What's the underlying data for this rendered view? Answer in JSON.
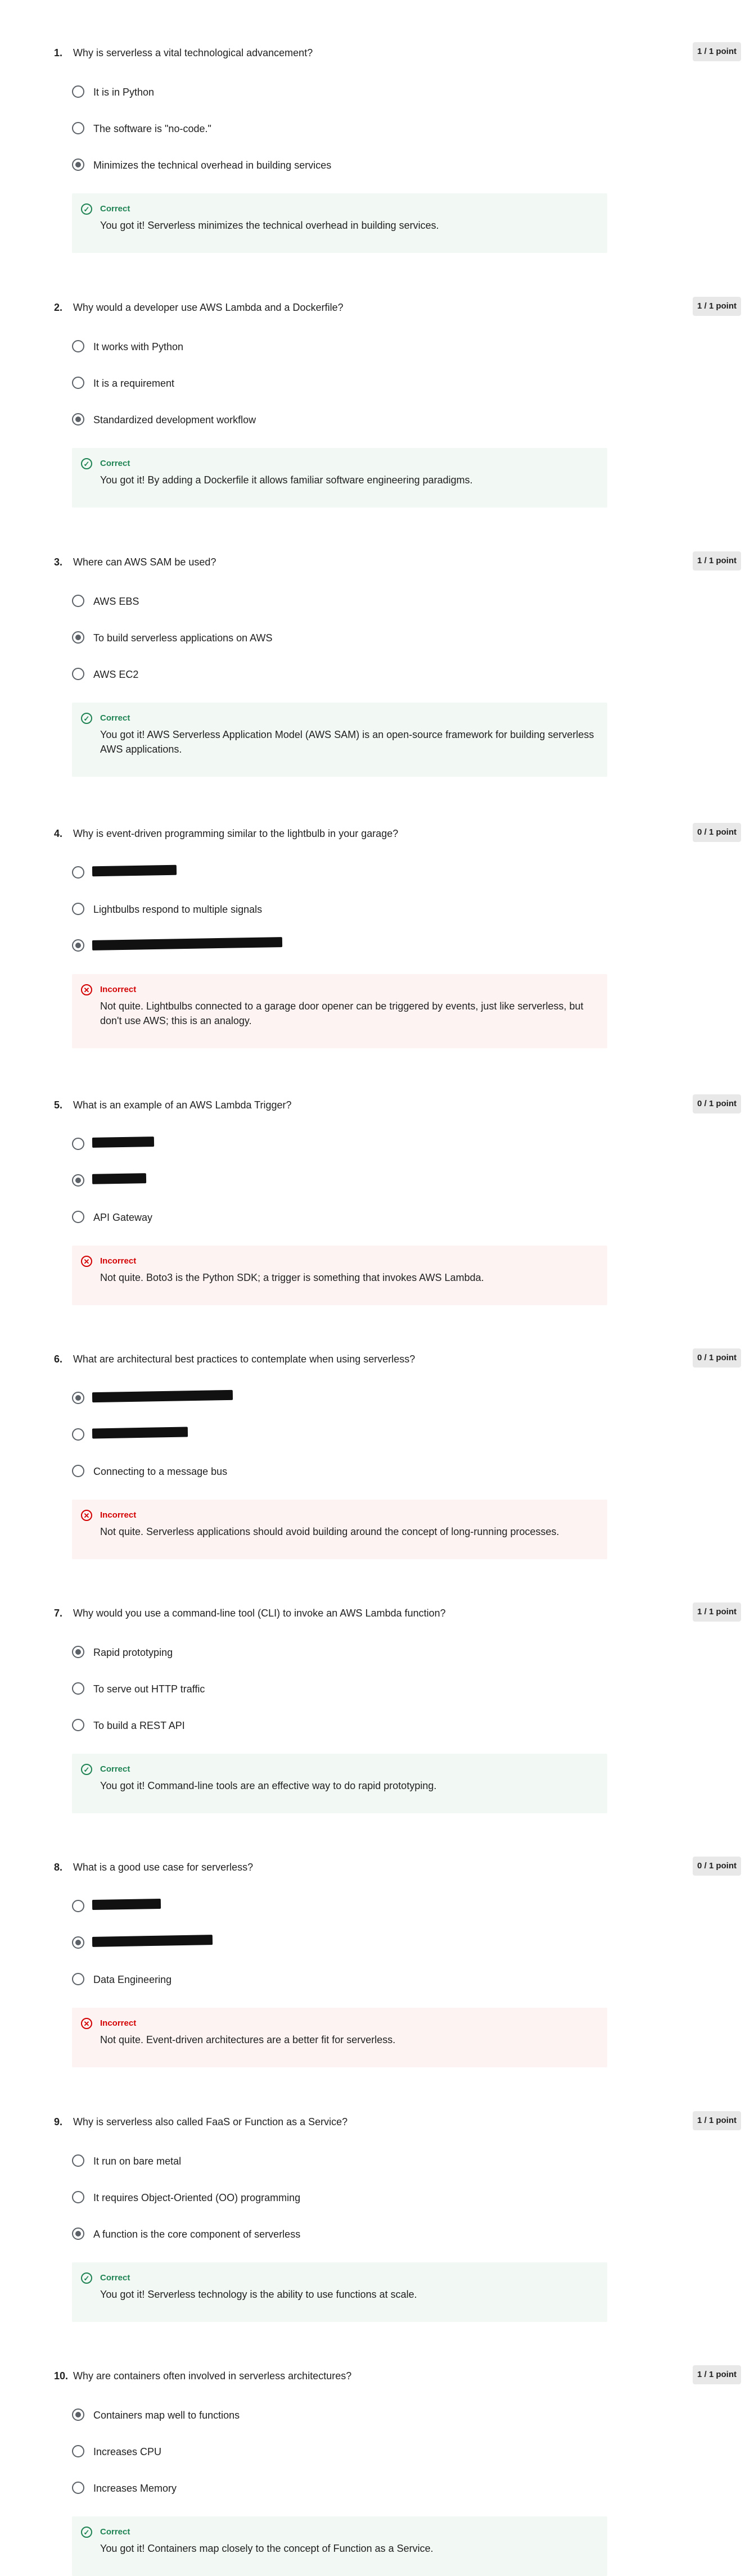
{
  "questions": [
    {
      "num": "1.",
      "text": "Why is serverless a vital technological advancement?",
      "points": "1 / 1 point",
      "options": [
        {
          "label": "It is in Python"
        },
        {
          "label": "The software is \"no-code.\""
        },
        {
          "label": "Minimizes the technical overhead in building services",
          "selected": true
        }
      ],
      "feedback": {
        "status": "correct",
        "title": "Correct",
        "text": "You got it! Serverless minimizes the technical overhead in building services."
      }
    },
    {
      "num": "2.",
      "text": "Why would a developer use AWS Lambda and a Dockerfile?",
      "points": "1 / 1 point",
      "options": [
        {
          "label": "It works with Python"
        },
        {
          "label": "It is a requirement"
        },
        {
          "label": "Standardized development workflow",
          "selected": true
        }
      ],
      "feedback": {
        "status": "correct",
        "title": "Correct",
        "text": "You got it! By adding a Dockerfile it allows familiar software engineering paradigms."
      }
    },
    {
      "num": "3.",
      "text": "Where can AWS SAM be used?",
      "points": "1 / 1 point",
      "options": [
        {
          "label": "AWS EBS"
        },
        {
          "label": "To build serverless applications on AWS",
          "selected": true
        },
        {
          "label": "AWS EC2"
        }
      ],
      "feedback": {
        "status": "correct",
        "title": "Correct",
        "text": "You got it! AWS Serverless Application Model (AWS SAM) is an open-source framework for building serverless AWS applications."
      }
    },
    {
      "num": "4.",
      "text": "Why is event-driven programming similar to the lightbulb in your garage?",
      "points": "0 / 1 point",
      "options": [
        {
          "label": "",
          "redacted": true
        },
        {
          "label": "Lightbulbs respond to multiple signals"
        },
        {
          "label": "",
          "redacted": true,
          "selected": true
        }
      ],
      "feedback": {
        "status": "incorrect",
        "title": "Incorrect",
        "text": "Not quite. Lightbulbs connected to a garage door opener can be triggered by events, just like serverless, but don't use AWS; this is an analogy."
      }
    },
    {
      "num": "5.",
      "text": "What is an example of an AWS Lambda Trigger?",
      "points": "0 / 1 point",
      "options": [
        {
          "label": "",
          "redacted": true
        },
        {
          "label": "",
          "redacted": true,
          "selected": true
        },
        {
          "label": "API Gateway"
        }
      ],
      "feedback": {
        "status": "incorrect",
        "title": "Incorrect",
        "text": "Not quite. Boto3 is the Python SDK; a trigger is something that invokes AWS Lambda."
      }
    },
    {
      "num": "6.",
      "text": "What are architectural best practices to contemplate when using serverless?",
      "points": "0 / 1 point",
      "options": [
        {
          "label": "",
          "redacted": true,
          "selected": true
        },
        {
          "label": "",
          "redacted": true
        },
        {
          "label": "Connecting to a message bus"
        }
      ],
      "feedback": {
        "status": "incorrect",
        "title": "Incorrect",
        "text": "Not quite. Serverless applications should avoid building around the concept of long-running processes."
      }
    },
    {
      "num": "7.",
      "text": "Why would you use a command-line tool (CLI) to invoke an AWS Lambda function?",
      "points": "1 / 1 point",
      "options": [
        {
          "label": "Rapid prototyping",
          "selected": true
        },
        {
          "label": "To serve out HTTP traffic"
        },
        {
          "label": "To build a REST API"
        }
      ],
      "feedback": {
        "status": "correct",
        "title": "Correct",
        "text": "You got it! Command-line tools are an effective way to do rapid prototyping."
      }
    },
    {
      "num": "8.",
      "text": "What is a good use case for serverless?",
      "points": "0 / 1 point",
      "options": [
        {
          "label": "",
          "redacted": true
        },
        {
          "label": "",
          "redacted": true,
          "selected": true
        },
        {
          "label": "Data Engineering"
        }
      ],
      "feedback": {
        "status": "incorrect",
        "title": "Incorrect",
        "text": "Not quite. Event-driven architectures are a better fit for serverless."
      }
    },
    {
      "num": "9.",
      "text": "Why is serverless also called FaaS or Function as a Service?",
      "points": "1 / 1 point",
      "options": [
        {
          "label": "It run on bare metal"
        },
        {
          "label": "It requires Object-Oriented (OO) programming"
        },
        {
          "label": "A function is the core component of serverless",
          "selected": true
        }
      ],
      "feedback": {
        "status": "correct",
        "title": "Correct",
        "text": "You got it! Serverless technology is the ability to use functions at scale."
      }
    },
    {
      "num": "10.",
      "text": "Why are containers often involved in serverless architectures?",
      "points": "1 / 1 point",
      "options": [
        {
          "label": "Containers map well to functions",
          "selected": true
        },
        {
          "label": "Increases CPU"
        },
        {
          "label": "Increases Memory"
        }
      ],
      "feedback": {
        "status": "correct",
        "title": "Correct",
        "text": "You got it! Containers map closely to the concept of Function as a Service."
      }
    }
  ],
  "icons": {
    "correct": "check-circle-icon",
    "incorrect": "x-circle-icon"
  },
  "colors": {
    "correct": "#1f8354",
    "incorrect": "#d30001",
    "correct_bg": "#f2f8f4",
    "incorrect_bg": "#fdf3f3"
  }
}
